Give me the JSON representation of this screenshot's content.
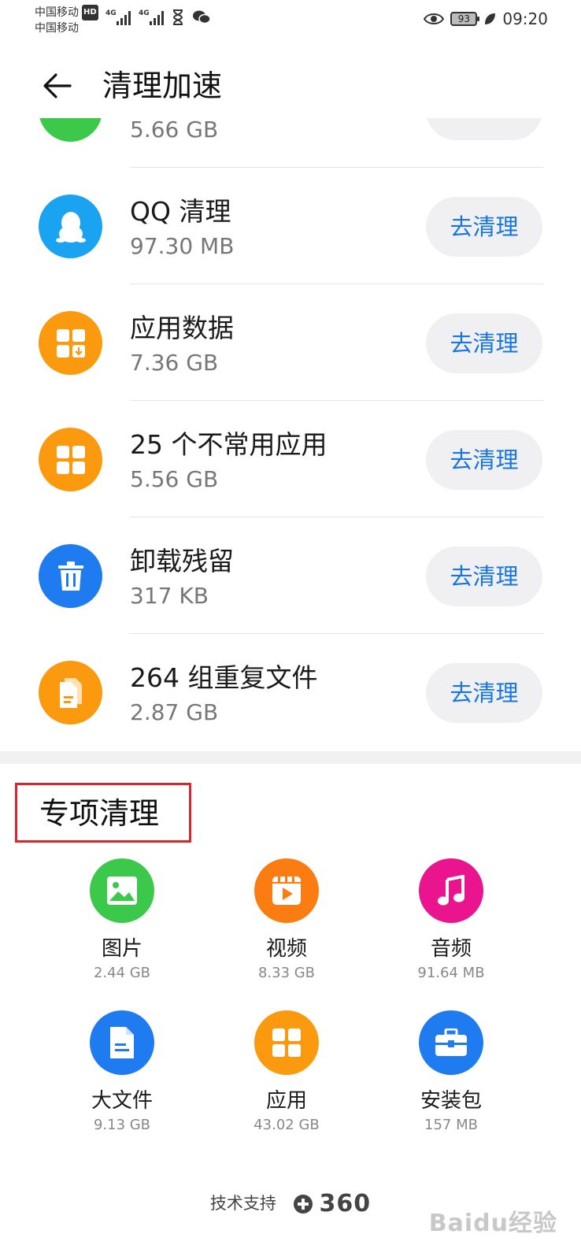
{
  "status_bar": {
    "carrier_1": "中国移动",
    "carrier_2": "中国移动",
    "hd_label": "HD",
    "network_1": "4G",
    "network_2": "4G",
    "battery": "93",
    "time": "09:20"
  },
  "header": {
    "title": "清理加速"
  },
  "clean_list": [
    {
      "name": "",
      "size": "5.66 GB",
      "button": "",
      "icon": "partial-green-icon",
      "color": "#3cc84a"
    },
    {
      "name": "QQ 清理",
      "size": "97.30 MB",
      "button": "去清理",
      "icon": "qq-penguin-icon",
      "color": "#1aa3f0"
    },
    {
      "name": "应用数据",
      "size": "7.36 GB",
      "button": "去清理",
      "icon": "app-data-icon",
      "color": "#fb9a0e"
    },
    {
      "name": "25 个不常用应用",
      "size": "5.56 GB",
      "button": "去清理",
      "icon": "apps-grid-icon",
      "color": "#fb9a0e"
    },
    {
      "name": "卸载残留",
      "size": "317 KB",
      "button": "去清理",
      "icon": "trash-icon",
      "color": "#1f7bf0"
    },
    {
      "name": "264 组重复文件",
      "size": "2.87 GB",
      "button": "去清理",
      "icon": "duplicate-file-icon",
      "color": "#fb9a0e"
    }
  ],
  "special": {
    "title": "专项清理",
    "items": [
      {
        "label": "图片",
        "size": "2.44 GB",
        "icon": "image-icon",
        "color": "#3cc84a"
      },
      {
        "label": "视频",
        "size": "8.33 GB",
        "icon": "video-icon",
        "color": "#fb7d12"
      },
      {
        "label": "音频",
        "size": "91.64 MB",
        "icon": "music-icon",
        "color": "#e9148e"
      },
      {
        "label": "大文件",
        "size": "9.13 GB",
        "icon": "document-icon",
        "color": "#1f7bf0"
      },
      {
        "label": "应用",
        "size": "43.02 GB",
        "icon": "apps-grid-icon",
        "color": "#fb9a0e"
      },
      {
        "label": "安装包",
        "size": "157 MB",
        "icon": "toolbox-icon",
        "color": "#1f7bf0"
      }
    ]
  },
  "footer": {
    "support_label": "技术支持",
    "brand": "360"
  },
  "watermark": "Baidu经验"
}
